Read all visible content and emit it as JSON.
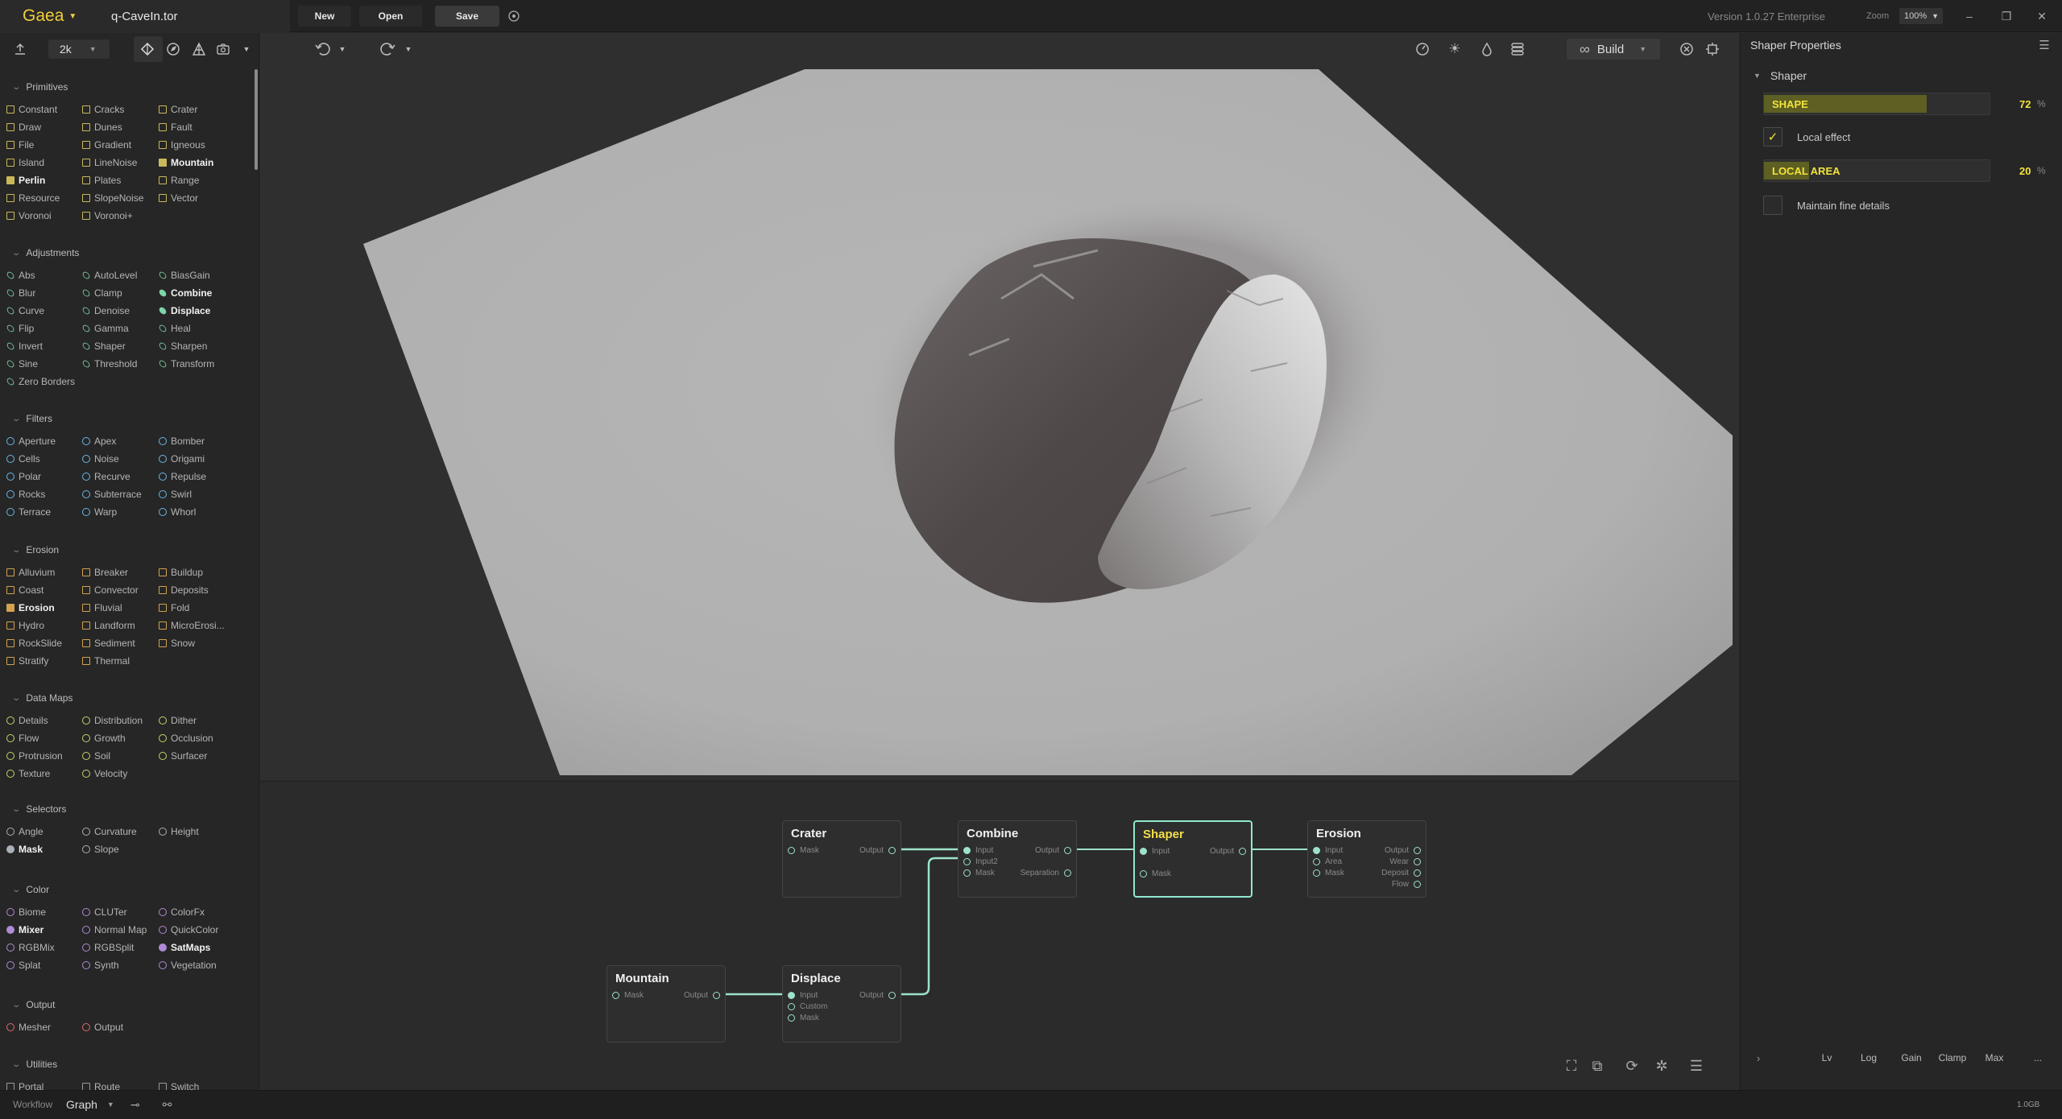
{
  "app": {
    "logo": "Gaea",
    "file": "q-CaveIn.tor",
    "version": "Version 1.0.27 Enterprise",
    "zoom_label": "Zoom",
    "zoom_value": "100%"
  },
  "toolbar": {
    "new": "New",
    "open": "Open",
    "save": "Save"
  },
  "left": {
    "resolution": "2k",
    "sections": [
      {
        "title": "Primitives",
        "shape": "sq",
        "color": "#c9b95a",
        "items": [
          [
            "Constant",
            "Cracks",
            "Crater"
          ],
          [
            "Draw",
            "Dunes",
            "Fault"
          ],
          [
            "File",
            "Gradient",
            "Igneous"
          ],
          [
            "Island",
            "LineNoise",
            "Mountain"
          ],
          [
            "Perlin",
            "Plates",
            "Range"
          ],
          [
            "Resource",
            "SlopeNoise",
            "Vector"
          ],
          [
            "Voronoi",
            "Voronoi+"
          ]
        ],
        "bold": [
          "Mountain",
          "Perlin"
        ]
      },
      {
        "title": "Adjustments",
        "shape": "ls",
        "color": "#7fd3a8",
        "items": [
          [
            "Abs",
            "AutoLevel",
            "BiasGain"
          ],
          [
            "Blur",
            "Clamp",
            "Combine"
          ],
          [
            "Curve",
            "Denoise",
            "Displace"
          ],
          [
            "Flip",
            "Gamma",
            "Heal"
          ],
          [
            "Invert",
            "Shaper",
            "Sharpen"
          ],
          [
            "Sine",
            "Threshold",
            "Transform"
          ],
          [
            "Zero Borders"
          ]
        ],
        "bold": [
          "Combine",
          "Displace"
        ]
      },
      {
        "title": "Filters",
        "shape": "ci",
        "color": "#6ab6e6",
        "items": [
          [
            "Aperture",
            "Apex",
            "Bomber"
          ],
          [
            "Cells",
            "Noise",
            "Origami"
          ],
          [
            "Polar",
            "Recurve",
            "Repulse"
          ],
          [
            "Rocks",
            "Subterrace",
            "Swirl"
          ],
          [
            "Terrace",
            "Warp",
            "Whorl"
          ]
        ],
        "bold": []
      },
      {
        "title": "Erosion",
        "shape": "sq",
        "color": "#d2a24d",
        "items": [
          [
            "Alluvium",
            "Breaker",
            "Buildup"
          ],
          [
            "Coast",
            "Convector",
            "Deposits"
          ],
          [
            "Erosion",
            "Fluvial",
            "Fold"
          ],
          [
            "Hydro",
            "Landform",
            "MicroErosi..."
          ],
          [
            "RockSlide",
            "Sediment",
            "Snow"
          ],
          [
            "Stratify",
            "Thermal"
          ]
        ],
        "bold": [
          "Erosion"
        ]
      },
      {
        "title": "Data Maps",
        "shape": "ci",
        "color": "#c9d16a",
        "items": [
          [
            "Details",
            "Distribution",
            "Dither"
          ],
          [
            "Flow",
            "Growth",
            "Occlusion"
          ],
          [
            "Protrusion",
            "Soil",
            "Surfacer"
          ],
          [
            "Texture",
            "Velocity"
          ]
        ],
        "bold": []
      },
      {
        "title": "Selectors",
        "shape": "ci",
        "color": "#aab0b8",
        "items": [
          [
            "Angle",
            "Curvature",
            "Height"
          ],
          [
            "Mask",
            "Slope"
          ]
        ],
        "bold": [
          "Mask"
        ]
      },
      {
        "title": "Color",
        "shape": "ci",
        "color": "#b08ad6",
        "items": [
          [
            "Biome",
            "CLUTer",
            "ColorFx"
          ],
          [
            "Mixer",
            "Normal Map",
            "QuickColor"
          ],
          [
            "RGBMix",
            "RGBSplit",
            "SatMaps"
          ],
          [
            "Splat",
            "Synth",
            "Vegetation"
          ]
        ],
        "bold": [
          "Mixer",
          "SatMaps"
        ]
      },
      {
        "title": "Output",
        "shape": "ci",
        "color": "#e06a6a",
        "items": [
          [
            "Mesher",
            "Output"
          ]
        ],
        "bold": []
      },
      {
        "title": "Utilities",
        "shape": "sq",
        "color": "#9a9a9a",
        "items": [
          [
            "Portal",
            "Route",
            "Switch"
          ]
        ],
        "bold": []
      }
    ]
  },
  "viewport": {
    "build_label": "Build"
  },
  "graph": {
    "nodes": [
      {
        "id": "crater",
        "title": "Crater",
        "ports": [
          "Mask",
          "Output"
        ]
      },
      {
        "id": "combine",
        "title": "Combine",
        "ports": [
          "Input",
          "Input2",
          "Mask",
          "Output",
          "Separation"
        ]
      },
      {
        "id": "shaper",
        "title": "Shaper",
        "ports": [
          "Input",
          "Mask",
          "Output"
        ]
      },
      {
        "id": "erosion",
        "title": "Erosion",
        "ports": [
          "Input",
          "Area",
          "Mask",
          "Output",
          "Wear",
          "Deposit",
          "Flow"
        ]
      },
      {
        "id": "mountain",
        "title": "Mountain",
        "ports": [
          "Mask",
          "Output"
        ]
      },
      {
        "id": "displace",
        "title": "Displace",
        "ports": [
          "Input",
          "Custom",
          "Mask",
          "Output"
        ]
      }
    ]
  },
  "props": {
    "title": "Shaper Properties",
    "section": "Shaper",
    "shape": {
      "label": "SHAPE",
      "value": "72",
      "unit": "%",
      "fraction": 0.72
    },
    "local_effect": {
      "label": "Local effect",
      "checked": true
    },
    "local_area": {
      "label": "LOCAL AREA",
      "value": "20",
      "unit": "%",
      "fraction": 0.2
    },
    "fine_details": {
      "label": "Maintain fine details",
      "checked": false
    },
    "tabs": [
      "Lv",
      "Log",
      "Gain",
      "Clamp",
      "Max"
    ],
    "more": "..."
  },
  "bottom": {
    "workflow": "Workflow",
    "mode": "Graph",
    "memory": "1.0GB"
  },
  "colors": {
    "accent": "#f2e43a",
    "wire": "#9de3c9"
  }
}
